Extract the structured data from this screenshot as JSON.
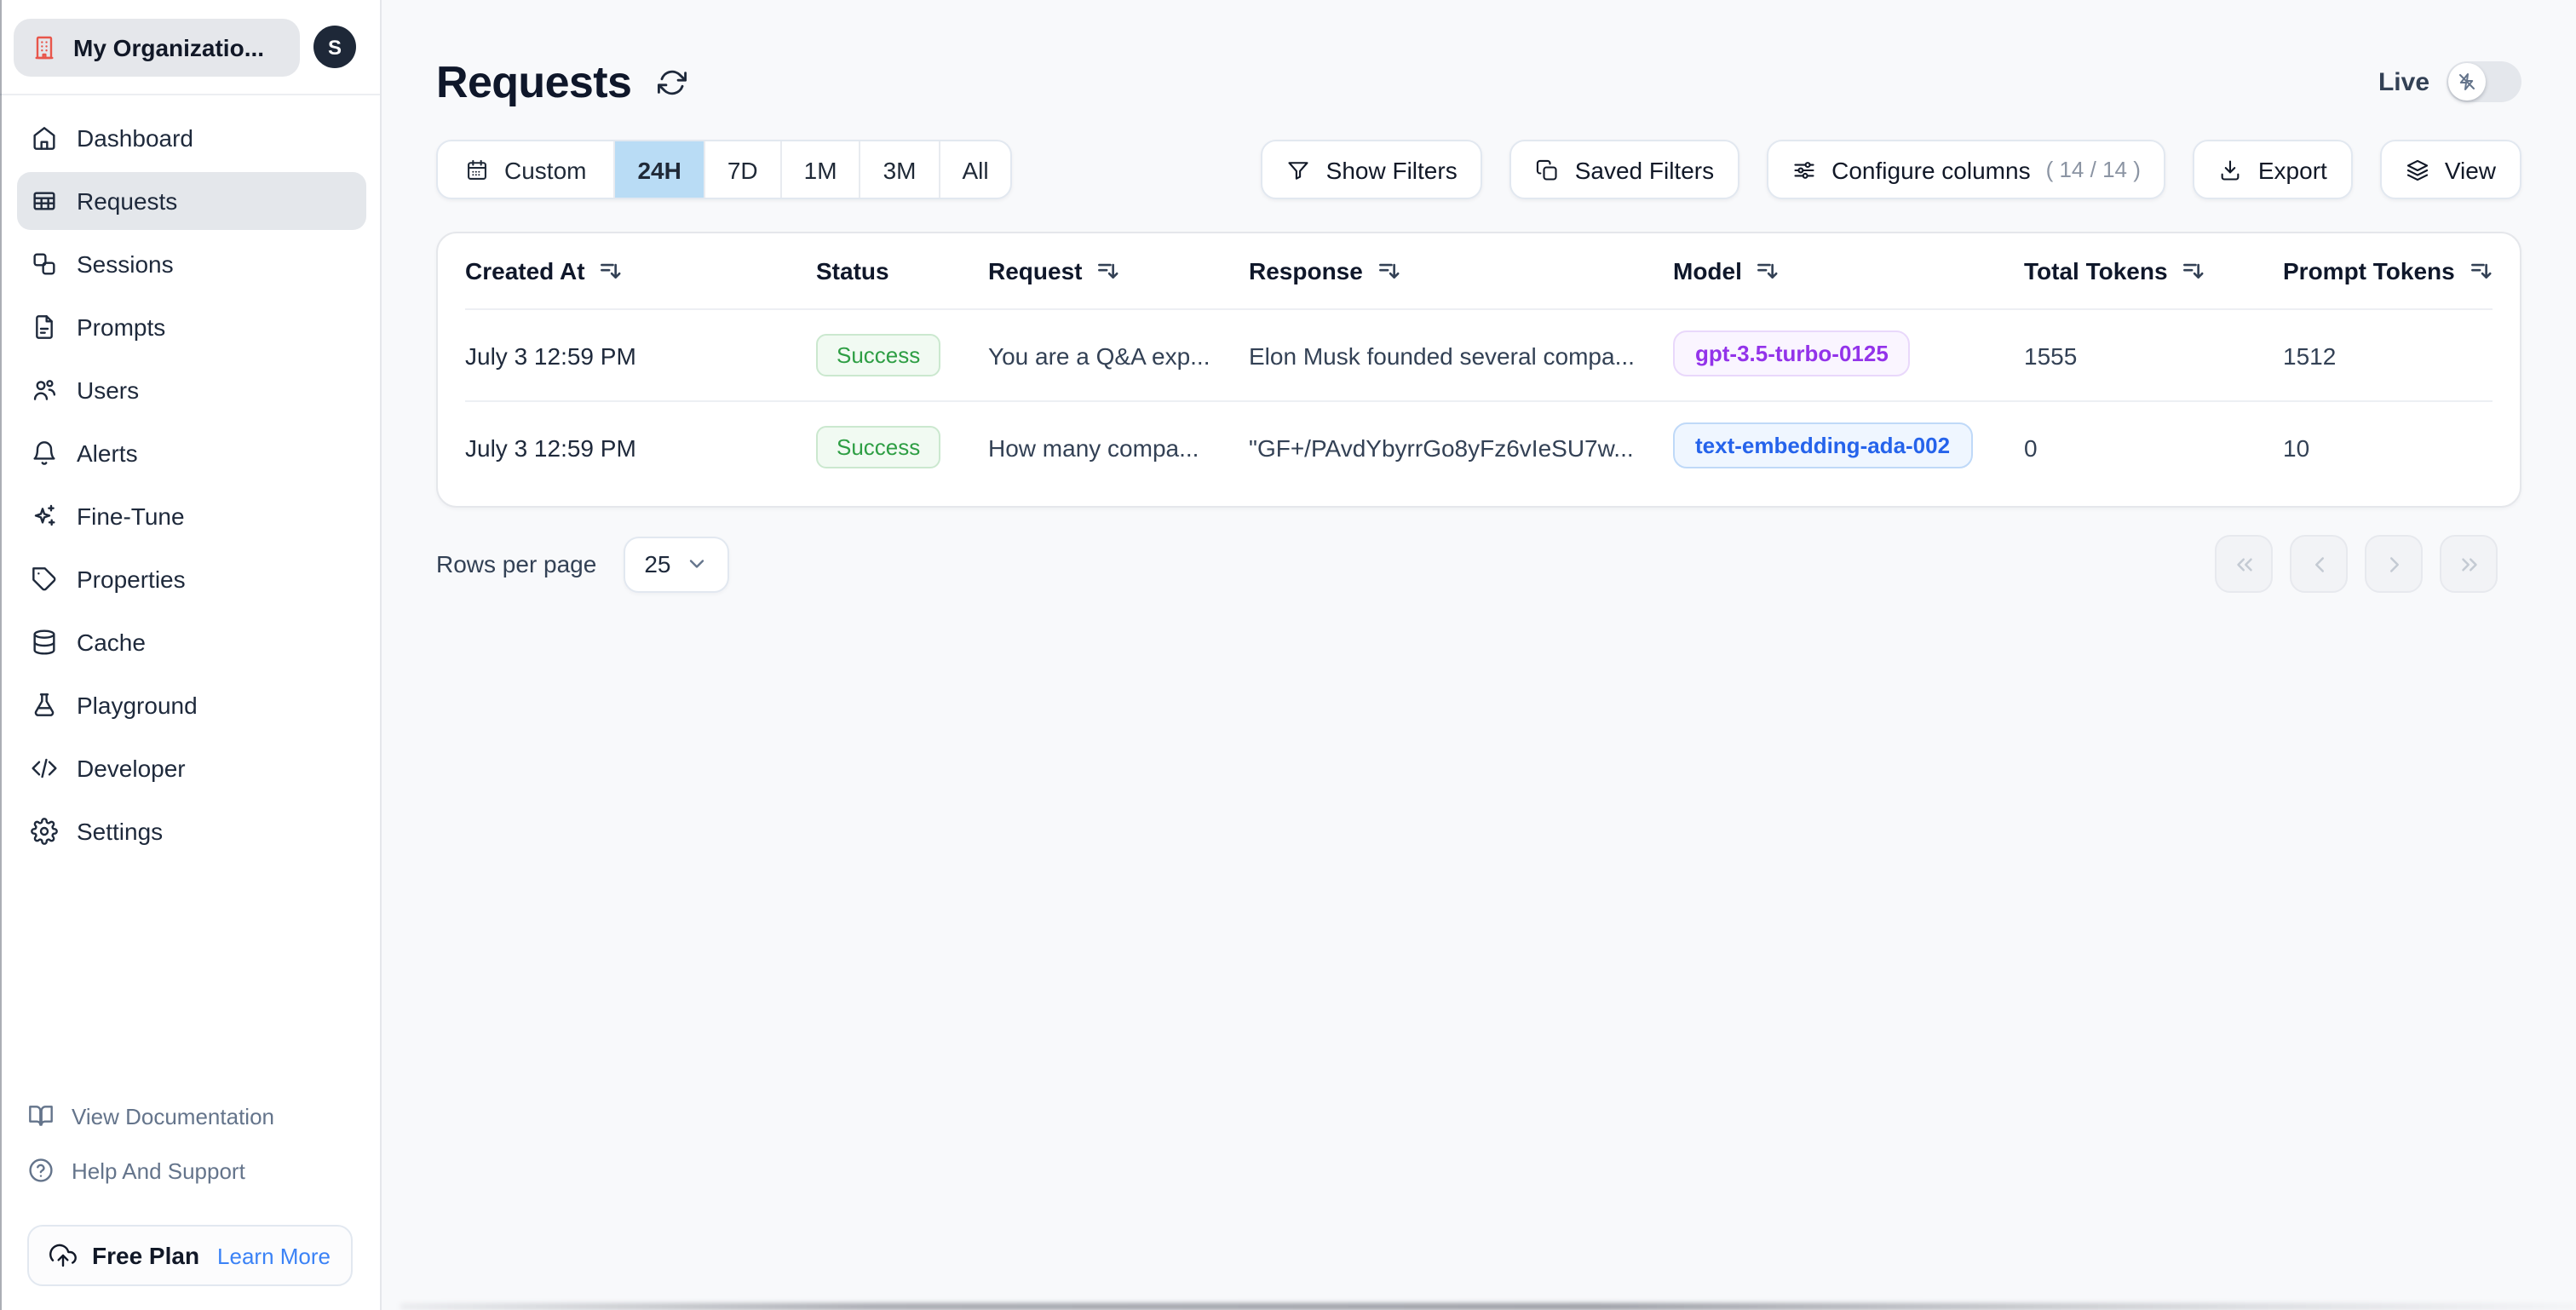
{
  "org": {
    "name": "My Organizatio...",
    "avatar_initial": "S"
  },
  "sidebar": {
    "items": [
      {
        "label": "Dashboard",
        "icon": "home-icon",
        "active": false
      },
      {
        "label": "Requests",
        "icon": "table-icon",
        "active": true
      },
      {
        "label": "Sessions",
        "icon": "sessions-icon",
        "active": false
      },
      {
        "label": "Prompts",
        "icon": "document-icon",
        "active": false
      },
      {
        "label": "Users",
        "icon": "users-icon",
        "active": false
      },
      {
        "label": "Alerts",
        "icon": "bell-icon",
        "active": false
      },
      {
        "label": "Fine-Tune",
        "icon": "sparkles-icon",
        "active": false
      },
      {
        "label": "Properties",
        "icon": "tag-icon",
        "active": false
      },
      {
        "label": "Cache",
        "icon": "database-icon",
        "active": false
      },
      {
        "label": "Playground",
        "icon": "flask-icon",
        "active": false
      },
      {
        "label": "Developer",
        "icon": "code-icon",
        "active": false
      },
      {
        "label": "Settings",
        "icon": "gear-icon",
        "active": false
      }
    ],
    "footer": {
      "docs_label": "View Documentation",
      "help_label": "Help And Support",
      "plan_label": "Free Plan",
      "plan_link_label": "Learn More"
    }
  },
  "header": {
    "title": "Requests",
    "live_label": "Live",
    "live_on": false
  },
  "toolbar": {
    "time_ranges": [
      {
        "label": "Custom",
        "selected": false
      },
      {
        "label": "24H",
        "selected": true
      },
      {
        "label": "7D",
        "selected": false
      },
      {
        "label": "1M",
        "selected": false
      },
      {
        "label": "3M",
        "selected": false
      },
      {
        "label": "All",
        "selected": false
      }
    ],
    "show_filters_label": "Show Filters",
    "saved_filters_label": "Saved Filters",
    "configure_columns_label": "Configure columns",
    "configure_columns_count": "( 14 / 14 )",
    "export_label": "Export",
    "view_label": "View"
  },
  "table": {
    "columns": [
      {
        "label": "Created At",
        "sortable": true
      },
      {
        "label": "Status",
        "sortable": false
      },
      {
        "label": "Request",
        "sortable": true
      },
      {
        "label": "Response",
        "sortable": true
      },
      {
        "label": "Model",
        "sortable": true
      },
      {
        "label": "Total Tokens",
        "sortable": true
      },
      {
        "label": "Prompt Tokens",
        "sortable": true
      }
    ],
    "rows": [
      {
        "created_at": "July 3 12:59 PM",
        "status": "Success",
        "request": "You are a Q&A exp...",
        "response": "Elon Musk founded several compa...",
        "model": "gpt-3.5-turbo-0125",
        "model_variant": "purple",
        "total_tokens": "1555",
        "prompt_tokens": "1512"
      },
      {
        "created_at": "July 3 12:59 PM",
        "status": "Success",
        "request": "How many compa...",
        "response": "\"GF+/PAvdYbyrrGo8yFz6vIeSU7w...",
        "model": "text-embedding-ada-002",
        "model_variant": "blue",
        "total_tokens": "0",
        "prompt_tokens": "10"
      }
    ]
  },
  "pagination": {
    "rows_per_page_label": "Rows per page",
    "rows_per_page_value": "25"
  },
  "colors": {
    "brand_red": "#e8564b",
    "selected_range_blue": "#b9dcf5",
    "success_green": "#2e9e44",
    "model_purple": "#9333ea",
    "model_blue": "#2563eb",
    "link_blue": "#3b82f6",
    "sidebar_active_bg": "#e4e7eb",
    "page_bg": "#f8f9fb"
  }
}
